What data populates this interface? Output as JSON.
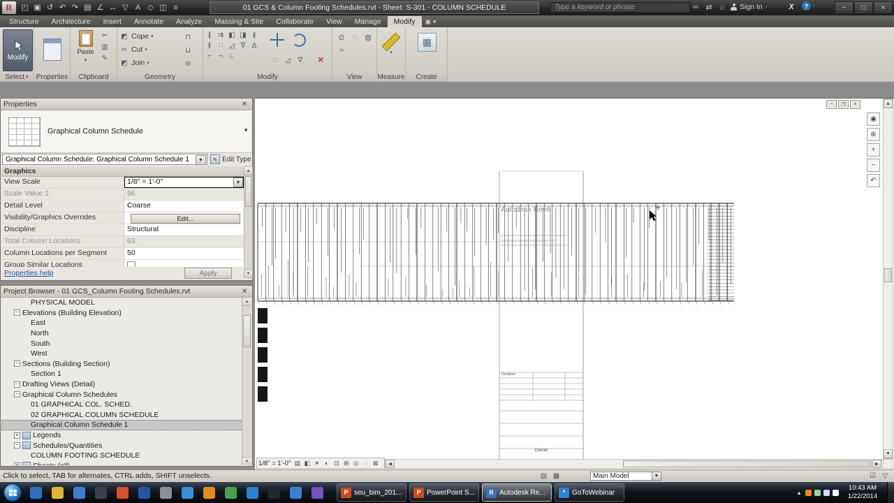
{
  "titlebar": {
    "document_title": "01 GCS & Column Footing Schedules.rvt - Sheet: S-301 - COLUMN SCHEDULE",
    "search_placeholder": "Type a keyword or phrase",
    "sign_in_label": "Sign In",
    "qat_icons": [
      "open",
      "save",
      "sync",
      "undo",
      "redo",
      "print",
      "measure",
      "aligned-dimension",
      "tag",
      "text",
      "default-3d-view",
      "section",
      "thin-lines"
    ],
    "info_icons": [
      "search",
      "communication-center",
      "favorites"
    ],
    "window_icons": [
      "minimize",
      "maximize",
      "close"
    ]
  },
  "ribbon": {
    "tabs": [
      "Structure",
      "Architecture",
      "Insert",
      "Annotate",
      "Analyze",
      "Massing & Site",
      "Collaborate",
      "View",
      "Manage",
      "Modify"
    ],
    "active_tab": "Modify",
    "panels": {
      "select": {
        "label": "Select",
        "modify_button": "Modify"
      },
      "properties": {
        "label": "Properties"
      },
      "clipboard": {
        "label": "Clipboard",
        "paste_button": "Paste",
        "icons": [
          "cut",
          "copy",
          "match-type"
        ]
      },
      "geometry": {
        "label": "Geometry",
        "buttons": [
          "Cope",
          "Cut",
          "Join"
        ],
        "icons": [
          "beam-coping",
          "wall-joins",
          "unjoin"
        ]
      },
      "modify": {
        "label": "Modify",
        "icons": [
          "align",
          "offset",
          "mirror-axis",
          "mirror-pick",
          "split",
          "split-gap",
          "array",
          "scale",
          "pin",
          "unpin",
          "trim-corner",
          "trim-single",
          "trim-multiple"
        ],
        "big_icons": [
          "move",
          "rotate"
        ],
        "extra_icons": [
          "array",
          "scale",
          "pin"
        ],
        "delete_icon": "delete"
      },
      "view": {
        "label": "View",
        "icons": [
          "activate-dimensions",
          "hide-in-view",
          "override-graphics",
          "linework"
        ]
      },
      "measure": {
        "label": "Measure",
        "icons": [
          "measure"
        ]
      },
      "create": {
        "label": "Create",
        "icons": [
          "create-group"
        ]
      }
    }
  },
  "properties": {
    "title": "Properties",
    "type_name": "Graphical Column Schedule",
    "type_selector": "Graphical Column Schedule: Graphical Column Schedule 1",
    "edit_type_label": "Edit Type",
    "section_label": "Graphics",
    "rows": [
      {
        "label": "View Scale",
        "value": "1/8\" = 1'-0\"",
        "kind": "scale"
      },
      {
        "label": "Scale Value 1:",
        "value": "96",
        "kind": "disabled"
      },
      {
        "label": "Detail Level",
        "value": "Coarse",
        "kind": "normal"
      },
      {
        "label": "Visibility/Graphics Overrides",
        "value": "Edit...",
        "kind": "button"
      },
      {
        "label": "Discipline",
        "value": "Structural",
        "kind": "normal"
      },
      {
        "label": "Total Column Locations",
        "value": "63",
        "kind": "disabled"
      },
      {
        "label": "Column Locations per Segment",
        "value": "50",
        "kind": "normal"
      },
      {
        "label": "Group Similar Locations",
        "value": "",
        "kind": "checkbox"
      }
    ],
    "help_link": "Properties help",
    "apply_label": "Apply"
  },
  "project_browser": {
    "title": "Project Browser - 01 GCS_Column Footing Schedules.rvt",
    "items": [
      {
        "label": "PHYSICAL MODEL",
        "indent": 3
      },
      {
        "label": "Elevations (Building Elevation)",
        "indent": 1,
        "exp": "minus"
      },
      {
        "label": "East",
        "indent": 3
      },
      {
        "label": "North",
        "indent": 3
      },
      {
        "label": "South",
        "indent": 3
      },
      {
        "label": "West",
        "indent": 3
      },
      {
        "label": "Sections (Building Section)",
        "indent": 1,
        "exp": "minus"
      },
      {
        "label": "Section 1",
        "indent": 3
      },
      {
        "label": "Drafting Views (Detail)",
        "indent": 1,
        "exp": "minus"
      },
      {
        "label": "Graphical Column Schedules",
        "indent": 1,
        "exp": "minus"
      },
      {
        "label": "01 GRAPHICAL COL. SCHED.",
        "indent": 3
      },
      {
        "label": "02 GRAPHICAL COLUMN SCHEDULE",
        "indent": 3
      },
      {
        "label": "Graphical Column Schedule 1",
        "indent": 3,
        "selected": true
      },
      {
        "label": "Legends",
        "indent": 1,
        "exp": "plus",
        "icon": "legends"
      },
      {
        "label": "Schedules/Quantities",
        "indent": 1,
        "exp": "minus",
        "icon": "schedules"
      },
      {
        "label": "COLUMN FOOTING SCHEDULE",
        "indent": 3
      },
      {
        "label": "Sheets (all)",
        "indent": 1,
        "exp": "plus",
        "icon": "sheets"
      }
    ]
  },
  "canvas": {
    "watermark": "Autodesk Revit",
    "view_scale": "1/8\" = 1'-0\"",
    "titleblock": {
      "designer": "Designer",
      "owner": "Owner"
    },
    "viewbar_icons": [
      "detail-level",
      "visual-style",
      "sun-path",
      "shadows",
      "crop-view",
      "crop-region",
      "temporary-hide",
      "reveal-hidden",
      "lock-position"
    ],
    "nav_icons": [
      "steering-wheel",
      "zoom",
      "zoom-in",
      "zoom-out",
      "previous"
    ],
    "view_window_icons": [
      "view-minimize",
      "view-restore",
      "view-close"
    ]
  },
  "statusbar": {
    "message": "Click to select, TAB for alternates, CTRL adds, SHIFT unselects.",
    "left_icons": [
      "worksets",
      "design-options"
    ],
    "main_model_label": "Main Model",
    "right_icons": [
      "editable-only",
      "filter"
    ]
  },
  "taskbar": {
    "pinned_colors": [
      "#2f6fc0",
      "#e0b531",
      "#3f7fd0",
      "#39424e",
      "#d94f2b",
      "#2456a4",
      "#8a8f98",
      "#3f8fd0",
      "#e58a1f",
      "#49a04a",
      "#2f7fd4",
      "#23262b",
      "#3f7fd0",
      "#7a4fc0"
    ],
    "apps": [
      {
        "label": "seu_bim_201...",
        "color": "#cb4a22",
        "glyph": "P",
        "active": false
      },
      {
        "label": "PowerPoint S...",
        "color": "#cb4a22",
        "glyph": "P",
        "active": false
      },
      {
        "label": "Autodesk Re...",
        "color": "#3d6fb4",
        "glyph": "R",
        "active": true
      },
      {
        "label": "GoToWebinar",
        "color": "#2f7fd4",
        "glyph": "*",
        "active": false
      }
    ],
    "tray_colors": [
      "#f18a00",
      "#9ad29a",
      "#cfd8ff",
      "#ffffff"
    ],
    "time": "10:43 AM",
    "date": "1/22/2014"
  }
}
